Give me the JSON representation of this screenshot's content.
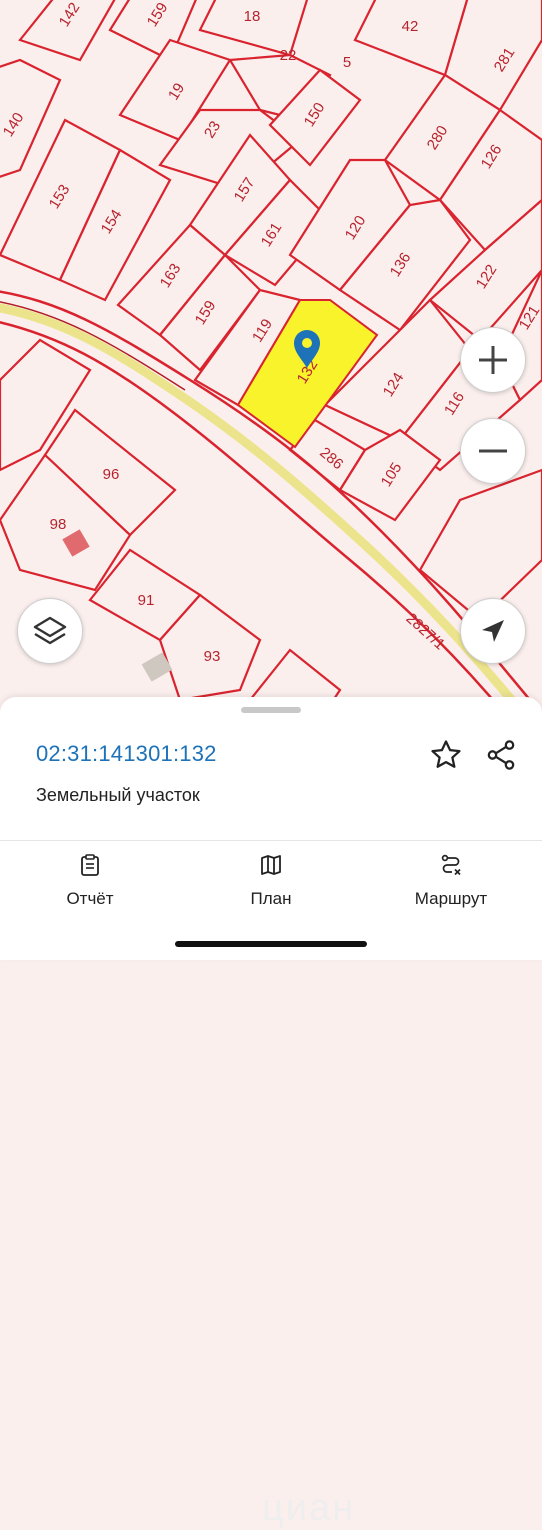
{
  "map": {
    "plots": [
      {
        "label": "142"
      },
      {
        "label": "159"
      },
      {
        "label": "18"
      },
      {
        "label": "42"
      },
      {
        "label": "140"
      },
      {
        "label": "19"
      },
      {
        "label": "22"
      },
      {
        "label": "5"
      },
      {
        "label": "281"
      },
      {
        "label": "23"
      },
      {
        "label": "150"
      },
      {
        "label": "280"
      },
      {
        "label": "153"
      },
      {
        "label": "154"
      },
      {
        "label": "157"
      },
      {
        "label": "126"
      },
      {
        "label": "161"
      },
      {
        "label": "120"
      },
      {
        "label": "163"
      },
      {
        "label": "136"
      },
      {
        "label": "122"
      },
      {
        "label": "159"
      },
      {
        "label": "119"
      },
      {
        "label": "121"
      },
      {
        "label": "124"
      },
      {
        "label": "116"
      },
      {
        "label": "286"
      },
      {
        "label": "105"
      },
      {
        "label": "96"
      },
      {
        "label": "98"
      },
      {
        "label": "91"
      },
      {
        "label": "93"
      }
    ],
    "selected_plot_label": "132",
    "road_label": "2827/1",
    "highlight_color": "#f8f32b",
    "boundary_color": "#d9242f",
    "road_color": "#ece48c",
    "pin_color": "#1d72b8",
    "icons": {
      "zoom_in": "plus-icon",
      "zoom_out": "minus-icon",
      "layers": "layers-icon",
      "locate": "navigation-arrow-icon"
    }
  },
  "sheet": {
    "cadastral_number": "02:31:141301:132",
    "object_type": "Земельный участок",
    "watermark": "циан",
    "icons": {
      "favorite": "star-icon",
      "share": "share-icon"
    }
  },
  "tabs": [
    {
      "label": "Отчёт",
      "icon": "report-clipboard-icon"
    },
    {
      "label": "План",
      "icon": "map-plan-icon"
    },
    {
      "label": "Маршрут",
      "icon": "route-icon"
    }
  ]
}
